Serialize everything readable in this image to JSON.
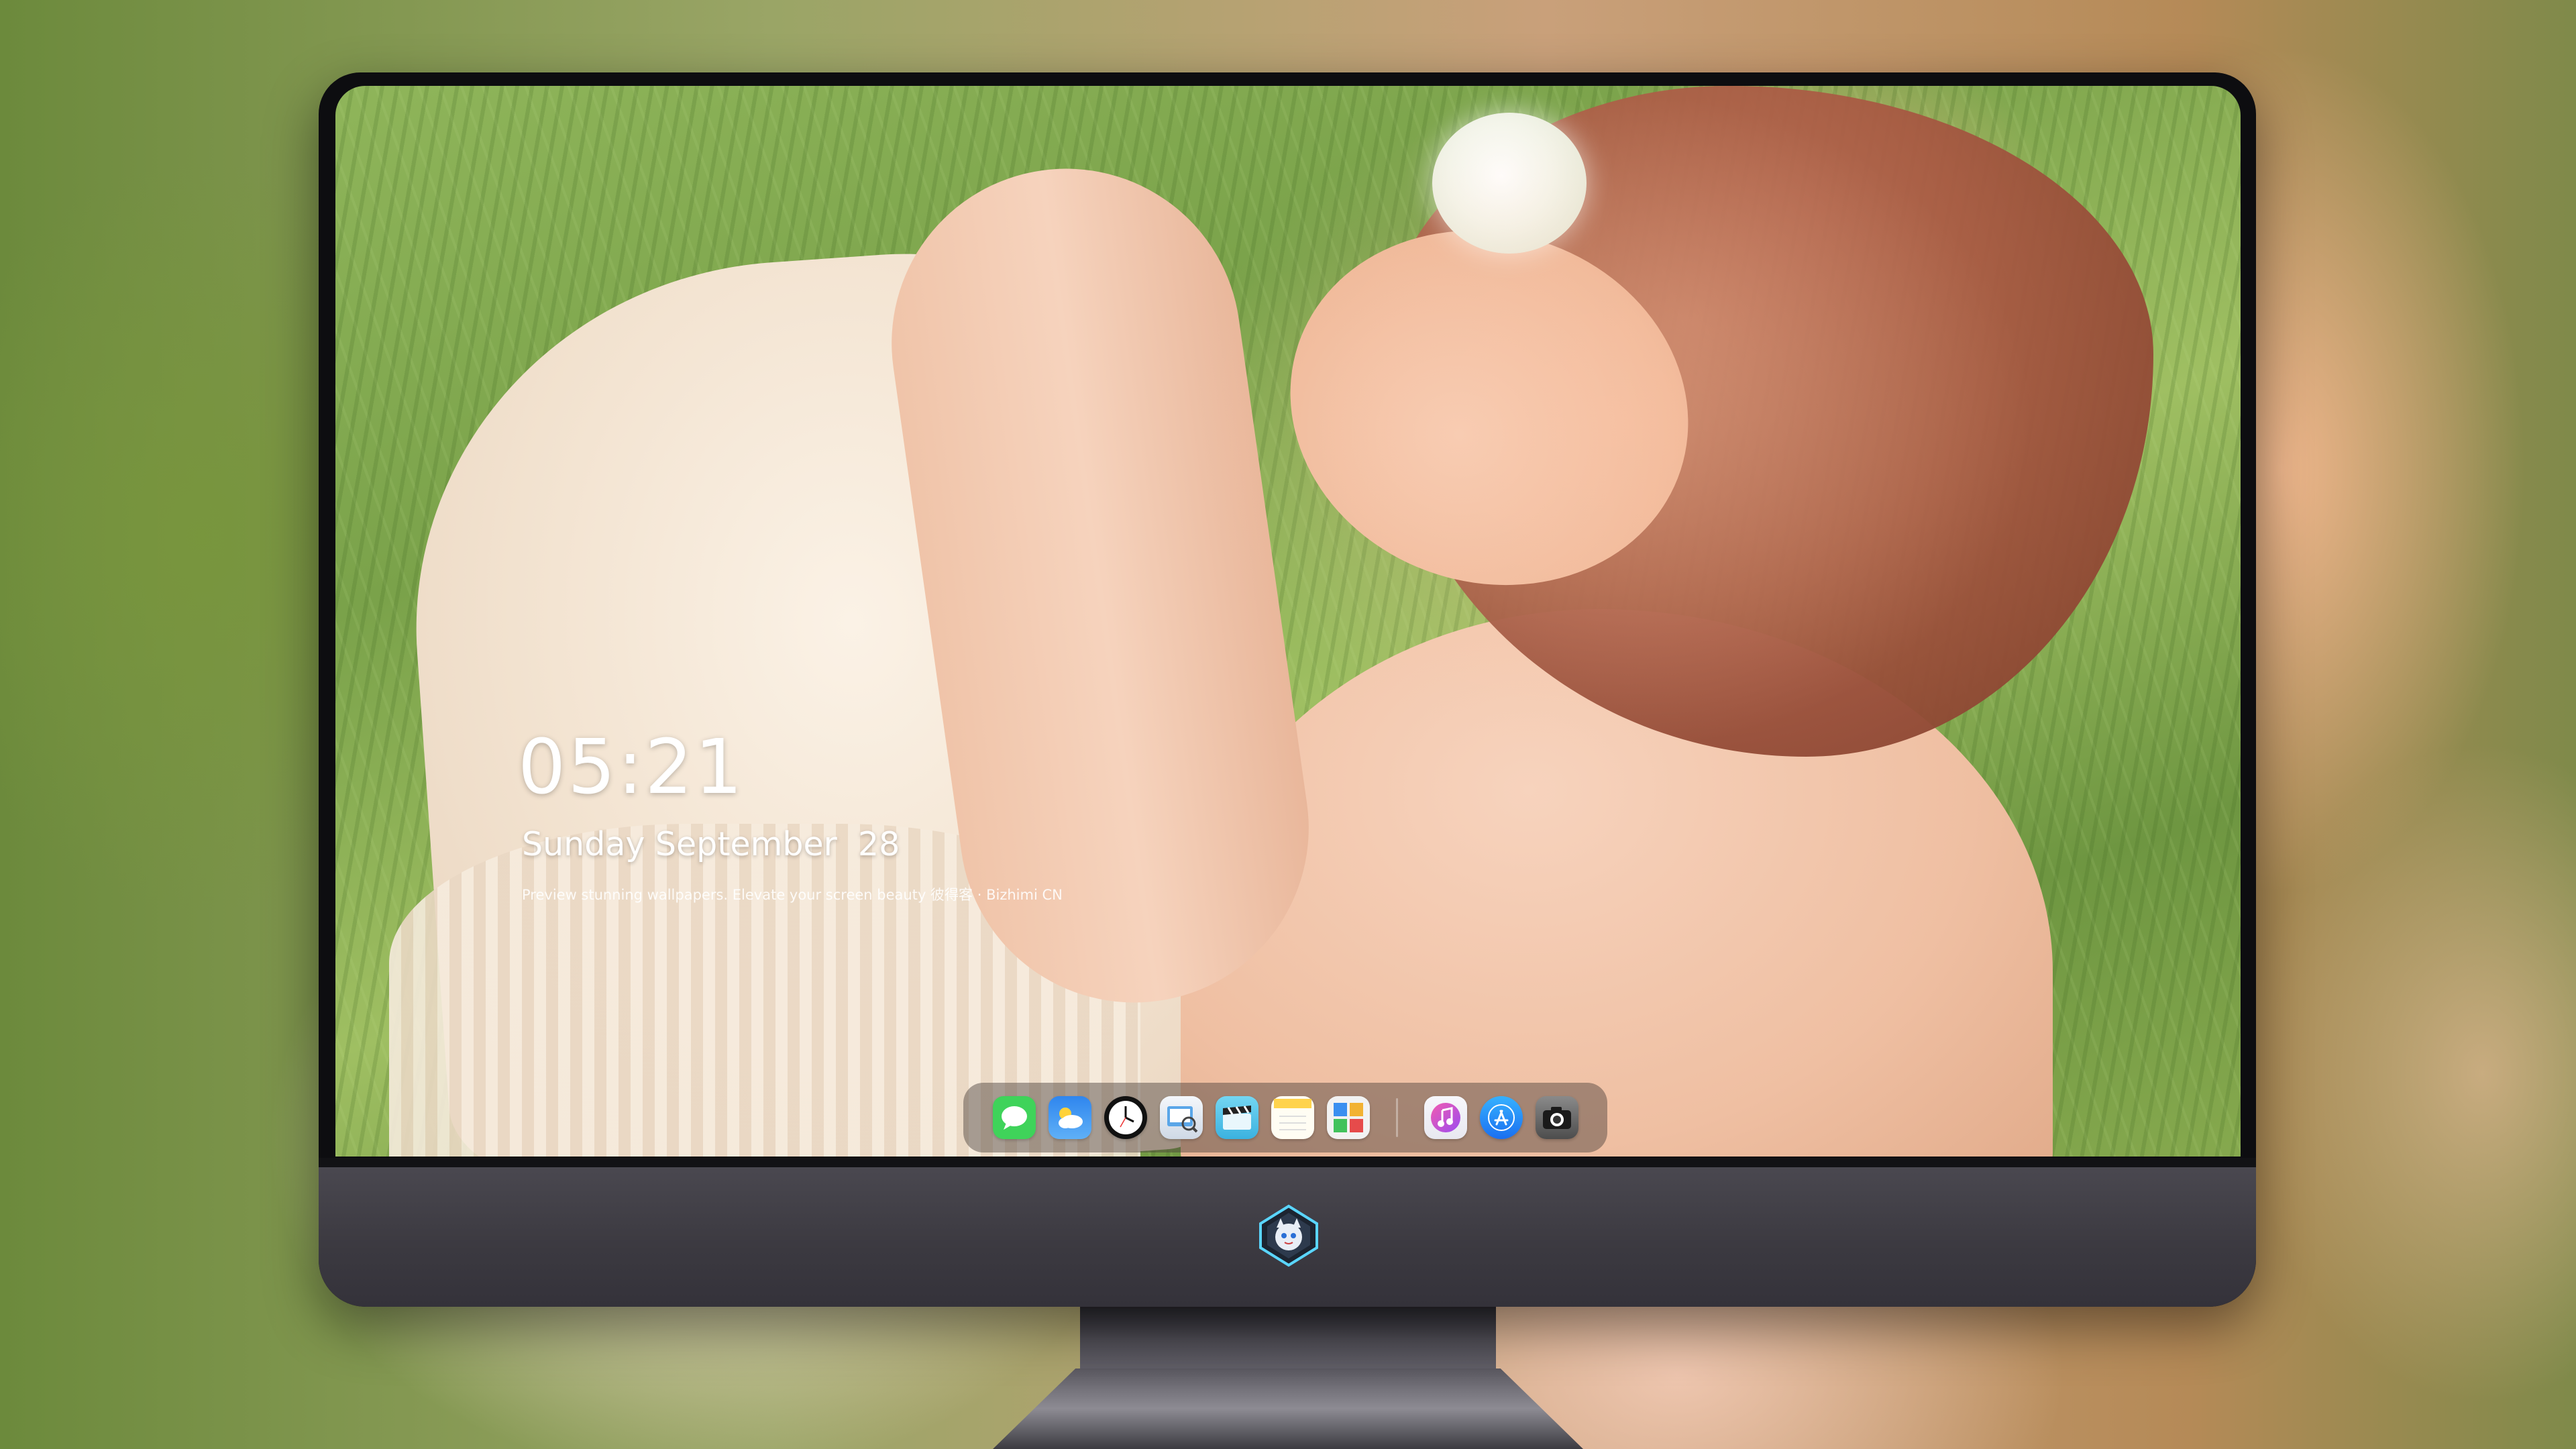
{
  "screen": {
    "clock": {
      "time": "05:21",
      "date": "Sunday September  28",
      "tagline": "Preview stunning wallpapers. Elevate your screen beauty 彼得客 · Bizhimi CN"
    }
  },
  "dock": {
    "icons": [
      {
        "name": "messages-icon",
        "color": "#3fd35a"
      },
      {
        "name": "weather-icon",
        "color": "#3a8ff0"
      },
      {
        "name": "clock-icon",
        "color": "#111111"
      },
      {
        "name": "preview-icon",
        "color": "#e9eef5"
      },
      {
        "name": "clapper-icon",
        "color": "#5bc8ea"
      },
      {
        "name": "notes-icon",
        "color": "#ffd34d"
      },
      {
        "name": "photo-booth-icon",
        "color": "#f2f2f2"
      },
      {
        "name": "music-icon",
        "color": "#f25bb0"
      },
      {
        "name": "app-store-icon",
        "color": "#1e8cf0"
      },
      {
        "name": "camera-icon",
        "color": "#6a6a6a"
      }
    ]
  },
  "colors": {
    "bezel": "#0d0d10",
    "chin": "#3c3a41",
    "logo_accent": "#5ad6ff"
  }
}
